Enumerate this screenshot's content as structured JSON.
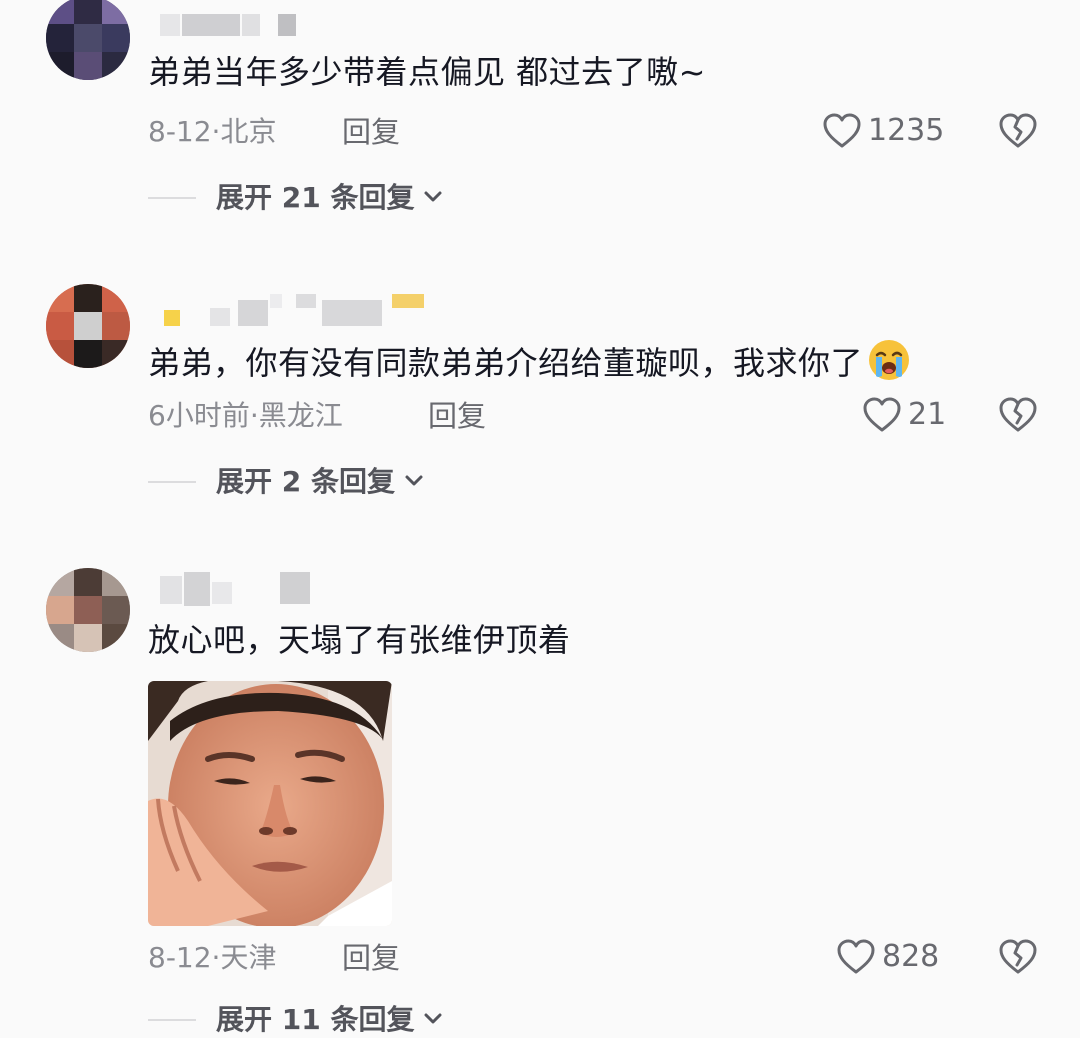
{
  "colors": {
    "background": "#fafafa",
    "text": "#161823",
    "meta_text": "#8a8b91",
    "icon": "#68696f"
  },
  "comments": [
    {
      "text": "弟弟当年多少带着点偏见 都过去了嗷~",
      "date": "8-12",
      "location": "北京",
      "reply_label": "回复",
      "likes": "1235",
      "expand_label": "展开 21 条回复",
      "avatar": "blurred-avatar",
      "username": "blurred-username"
    },
    {
      "text": "弟弟，你有没有同款弟弟介绍给董璇呗，我求你了",
      "emoji": "loudly-crying-face",
      "date": "6小时前",
      "location": "黑龙江",
      "reply_label": "回复",
      "likes": "21",
      "expand_label": "展开 2 条回复",
      "avatar": "blurred-avatar",
      "username": "blurred-username"
    },
    {
      "text": "放心吧，天塌了有张维伊顶着",
      "image": "man-resting-chin-on-hand-photo",
      "date": "8-12",
      "location": "天津",
      "reply_label": "回复",
      "likes": "828",
      "expand_label": "展开 11 条回复",
      "avatar": "blurred-avatar",
      "username": "blurred-username"
    }
  ],
  "separator": "·",
  "icons": {
    "like": "heart-outline-icon",
    "dislike": "broken-heart-icon",
    "expand": "chevron-down-icon"
  }
}
